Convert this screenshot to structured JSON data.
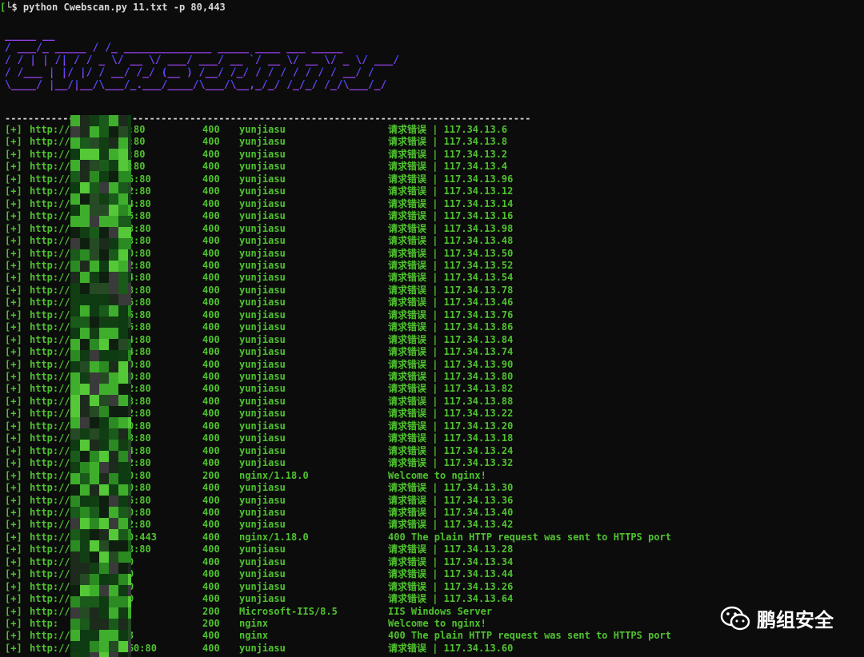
{
  "terminal": {
    "prompt_bracket": "[",
    "command": "└$ python Cwebscan.py 11.txt -p 80,443",
    "divider": "--------------        ---------------------------------------------------------------------"
  },
  "banner": {
    "art_lines": [
      "   _____              __",
      "  / ___/_      _____ / /_  ______________ _____  ____  ___  _____",
      " / /   | | /| / / _ \\/ __ \\/ ___/ ___/ __ `/ __ \\/ __ \\/ _ \\/ ___/",
      "/ /___ | |/ |/ /  __/ /_/ (__  ) /__/ /_/ / / / / / / /  __/ /",
      "\\____/ |__/|__/\\___/_.___/____/\\___/\\__,_/_/ /_/_/ /_/\\___/_/"
    ],
    "color_top": "#2c46f2",
    "color_bottom": "#a542f0"
  },
  "colors": {
    "green": "#4fc22f",
    "white": "#d8d8d8",
    "background": "#0c0c0c"
  },
  "results": [
    {
      "mark": "[+]",
      "url": "http://11      .6:80",
      "code": "400",
      "server": "yunjiasu",
      "title": "请求错误 | 117.34.13.6"
    },
    {
      "mark": "[+]",
      "url": "http://1       .8:80",
      "code": "400",
      "server": "yunjiasu",
      "title": "请求错误 | 117.34.13.8"
    },
    {
      "mark": "[+]",
      "url": "http://1       .2:80",
      "code": "400",
      "server": "yunjiasu",
      "title": "请求错误 | 117.34.13.2"
    },
    {
      "mark": "[+]",
      "url": "http://1       .4:80",
      "code": "400",
      "server": "yunjiasu",
      "title": "请求错误 | 117.34.13.4"
    },
    {
      "mark": "[+]",
      "url": "http://1       .96:80",
      "code": "400",
      "server": "yunjiasu",
      "title": "请求错误 | 117.34.13.96"
    },
    {
      "mark": "[+]",
      "url": "http://1       .12:80",
      "code": "400",
      "server": "yunjiasu",
      "title": "请求错误 | 117.34.13.12"
    },
    {
      "mark": "[+]",
      "url": "http://1       .14:80",
      "code": "400",
      "server": "yunjiasu",
      "title": "请求错误 | 117.34.13.14"
    },
    {
      "mark": "[+]",
      "url": "http://1       .16:80",
      "code": "400",
      "server": "yunjiasu",
      "title": "请求错误 | 117.34.13.16"
    },
    {
      "mark": "[+]",
      "url": "http://11      .98:80",
      "code": "400",
      "server": "yunjiasu",
      "title": "请求错误 | 117.34.13.98"
    },
    {
      "mark": "[+]",
      "url": "http://11      .48:80",
      "code": "400",
      "server": "yunjiasu",
      "title": "请求错误 | 117.34.13.48"
    },
    {
      "mark": "[+]",
      "url": "http://11      .50:80",
      "code": "400",
      "server": "yunjiasu",
      "title": "请求错误 | 117.34.13.50"
    },
    {
      "mark": "[+]",
      "url": "http://11      .52:80",
      "code": "400",
      "server": "yunjiasu",
      "title": "请求错误 | 117.34.13.52"
    },
    {
      "mark": "[+]",
      "url": "http://1       .54:80",
      "code": "400",
      "server": "yunjiasu",
      "title": "请求错误 | 117.34.13.54"
    },
    {
      "mark": "[+]",
      "url": "http://1       .78:80",
      "code": "400",
      "server": "yunjiasu",
      "title": "请求错误 | 117.34.13.78"
    },
    {
      "mark": "[+]",
      "url": "http://1       .46:80",
      "code": "400",
      "server": "yunjiasu",
      "title": "请求错误 | 117.34.13.46"
    },
    {
      "mark": "[+]",
      "url": "http://        .76:80",
      "code": "400",
      "server": "yunjiasu",
      "title": "请求错误 | 117.34.13.76"
    },
    {
      "mark": "[+]",
      "url": "http://        .86:80",
      "code": "400",
      "server": "yunjiasu",
      "title": "请求错误 | 117.34.13.86"
    },
    {
      "mark": "[+]",
      "url": "http://        .84:80",
      "code": "400",
      "server": "yunjiasu",
      "title": "请求错误 | 117.34.13.84"
    },
    {
      "mark": "[+]",
      "url": "http://        .74:80",
      "code": "400",
      "server": "yunjiasu",
      "title": "请求错误 | 117.34.13.74"
    },
    {
      "mark": "[+]",
      "url": "http://        .90:80",
      "code": "400",
      "server": "yunjiasu",
      "title": "请求错误 | 117.34.13.90"
    },
    {
      "mark": "[+]",
      "url": "http://        .80:80",
      "code": "400",
      "server": "yunjiasu",
      "title": "请求错误 | 117.34.13.80"
    },
    {
      "mark": "[+]",
      "url": "http://        .82:80",
      "code": "400",
      "server": "yunjiasu",
      "title": "请求错误 | 117.34.13.82"
    },
    {
      "mark": "[+]",
      "url": "http://        .88:80",
      "code": "400",
      "server": "yunjiasu",
      "title": "请求错误 | 117.34.13.88"
    },
    {
      "mark": "[+]",
      "url": "http://        .22:80",
      "code": "400",
      "server": "yunjiasu",
      "title": "请求错误 | 117.34.13.22"
    },
    {
      "mark": "[+]",
      "url": "http://        .20:80",
      "code": "400",
      "server": "yunjiasu",
      "title": "请求错误 | 117.34.13.20"
    },
    {
      "mark": "[+]",
      "url": "http://        .18:80",
      "code": "400",
      "server": "yunjiasu",
      "title": "请求错误 | 117.34.13.18"
    },
    {
      "mark": "[+]",
      "url": "http://        .24:80",
      "code": "400",
      "server": "yunjiasu",
      "title": "请求错误 | 117.34.13.24"
    },
    {
      "mark": "[+]",
      "url": "http://        .32:80",
      "code": "400",
      "server": "yunjiasu",
      "title": "请求错误 | 117.34.13.32"
    },
    {
      "mark": "[+]",
      "url": "http://        .10:80",
      "code": "200",
      "server": "nginx/1.18.0",
      "title": "Welcome to nginx!"
    },
    {
      "mark": "[+]",
      "url": "http://        .30:80",
      "code": "400",
      "server": "yunjiasu",
      "title": "请求错误 | 117.34.13.30"
    },
    {
      "mark": "[+]",
      "url": "http://        .36:80",
      "code": "400",
      "server": "yunjiasu",
      "title": "请求错误 | 117.34.13.36"
    },
    {
      "mark": "[+]",
      "url": "http://        .40:80",
      "code": "400",
      "server": "yunjiasu",
      "title": "请求错误 | 117.34.13.40"
    },
    {
      "mark": "[+]",
      "url": "http://        .42:80",
      "code": "400",
      "server": "yunjiasu",
      "title": "请求错误 | 117.34.13.42"
    },
    {
      "mark": "[+]",
      "url": "http://        .10:443",
      "code": "400",
      "server": "nginx/1.18.0",
      "title": "400 The plain HTTP request was sent to HTTPS port"
    },
    {
      "mark": "[+]",
      "url": "http://        .28:80",
      "code": "400",
      "server": "yunjiasu",
      "title": "请求错误 | 117.34.13.28"
    },
    {
      "mark": "[+]",
      "url": "http://        :80",
      "code": "400",
      "server": "yunjiasu",
      "title": "请求错误 | 117.34.13.34"
    },
    {
      "mark": "[+]",
      "url": "http://        :80",
      "code": "400",
      "server": "yunjiasu",
      "title": "请求错误 | 117.34.13.44"
    },
    {
      "mark": "[+]",
      "url": "http://        :80",
      "code": "400",
      "server": "yunjiasu",
      "title": "请求错误 | 117.34.13.26"
    },
    {
      "mark": "[+]",
      "url": "http://        :80",
      "code": "400",
      "server": "yunjiasu",
      "title": "请求错误 | 117.34.13.64"
    },
    {
      "mark": "[+]",
      "url": "http://        80",
      "code": "200",
      "server": "Microsoft-IIS/8.5",
      "title": "IIS Windows Server"
    },
    {
      "mark": "[+]",
      "url": "http:        80",
      "code": "200",
      "server": "nginx",
      "title": "Welcome to nginx!"
    },
    {
      "mark": "[+]",
      "url": "http://        443",
      "code": "400",
      "server": "nginx",
      "title": "400 The plain HTTP request was sent to HTTPS port"
    },
    {
      "mark": "[+]",
      "url": "http://117.34.13.60:80",
      "code": "400",
      "server": "yunjiasu",
      "title": "请求错误 | 117.34.13.60"
    }
  ],
  "watermark": {
    "text": "鹏组安全",
    "icon": "wechat-icon"
  }
}
